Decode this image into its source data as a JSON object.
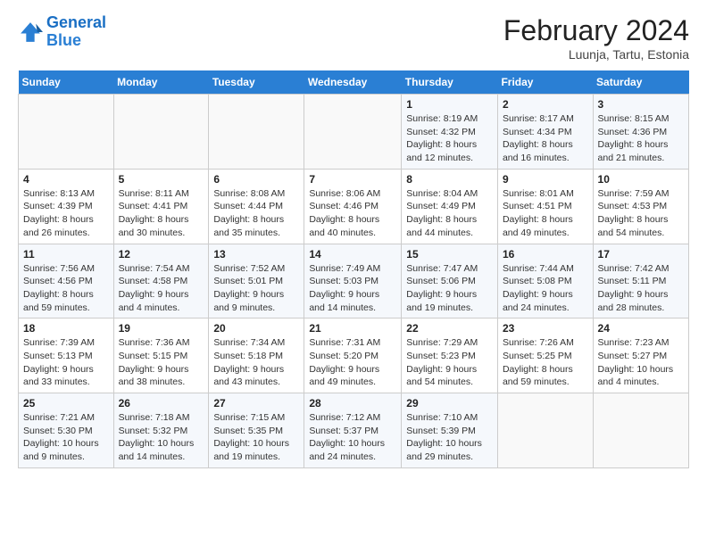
{
  "header": {
    "logo_line1": "General",
    "logo_line2": "Blue",
    "month_year": "February 2024",
    "location": "Luunja, Tartu, Estonia"
  },
  "weekdays": [
    "Sunday",
    "Monday",
    "Tuesday",
    "Wednesday",
    "Thursday",
    "Friday",
    "Saturday"
  ],
  "weeks": [
    [
      {
        "day": "",
        "info": ""
      },
      {
        "day": "",
        "info": ""
      },
      {
        "day": "",
        "info": ""
      },
      {
        "day": "",
        "info": ""
      },
      {
        "day": "1",
        "info": "Sunrise: 8:19 AM\nSunset: 4:32 PM\nDaylight: 8 hours and 12 minutes."
      },
      {
        "day": "2",
        "info": "Sunrise: 8:17 AM\nSunset: 4:34 PM\nDaylight: 8 hours and 16 minutes."
      },
      {
        "day": "3",
        "info": "Sunrise: 8:15 AM\nSunset: 4:36 PM\nDaylight: 8 hours and 21 minutes."
      }
    ],
    [
      {
        "day": "4",
        "info": "Sunrise: 8:13 AM\nSunset: 4:39 PM\nDaylight: 8 hours and 26 minutes."
      },
      {
        "day": "5",
        "info": "Sunrise: 8:11 AM\nSunset: 4:41 PM\nDaylight: 8 hours and 30 minutes."
      },
      {
        "day": "6",
        "info": "Sunrise: 8:08 AM\nSunset: 4:44 PM\nDaylight: 8 hours and 35 minutes."
      },
      {
        "day": "7",
        "info": "Sunrise: 8:06 AM\nSunset: 4:46 PM\nDaylight: 8 hours and 40 minutes."
      },
      {
        "day": "8",
        "info": "Sunrise: 8:04 AM\nSunset: 4:49 PM\nDaylight: 8 hours and 44 minutes."
      },
      {
        "day": "9",
        "info": "Sunrise: 8:01 AM\nSunset: 4:51 PM\nDaylight: 8 hours and 49 minutes."
      },
      {
        "day": "10",
        "info": "Sunrise: 7:59 AM\nSunset: 4:53 PM\nDaylight: 8 hours and 54 minutes."
      }
    ],
    [
      {
        "day": "11",
        "info": "Sunrise: 7:56 AM\nSunset: 4:56 PM\nDaylight: 8 hours and 59 minutes."
      },
      {
        "day": "12",
        "info": "Sunrise: 7:54 AM\nSunset: 4:58 PM\nDaylight: 9 hours and 4 minutes."
      },
      {
        "day": "13",
        "info": "Sunrise: 7:52 AM\nSunset: 5:01 PM\nDaylight: 9 hours and 9 minutes."
      },
      {
        "day": "14",
        "info": "Sunrise: 7:49 AM\nSunset: 5:03 PM\nDaylight: 9 hours and 14 minutes."
      },
      {
        "day": "15",
        "info": "Sunrise: 7:47 AM\nSunset: 5:06 PM\nDaylight: 9 hours and 19 minutes."
      },
      {
        "day": "16",
        "info": "Sunrise: 7:44 AM\nSunset: 5:08 PM\nDaylight: 9 hours and 24 minutes."
      },
      {
        "day": "17",
        "info": "Sunrise: 7:42 AM\nSunset: 5:11 PM\nDaylight: 9 hours and 28 minutes."
      }
    ],
    [
      {
        "day": "18",
        "info": "Sunrise: 7:39 AM\nSunset: 5:13 PM\nDaylight: 9 hours and 33 minutes."
      },
      {
        "day": "19",
        "info": "Sunrise: 7:36 AM\nSunset: 5:15 PM\nDaylight: 9 hours and 38 minutes."
      },
      {
        "day": "20",
        "info": "Sunrise: 7:34 AM\nSunset: 5:18 PM\nDaylight: 9 hours and 43 minutes."
      },
      {
        "day": "21",
        "info": "Sunrise: 7:31 AM\nSunset: 5:20 PM\nDaylight: 9 hours and 49 minutes."
      },
      {
        "day": "22",
        "info": "Sunrise: 7:29 AM\nSunset: 5:23 PM\nDaylight: 9 hours and 54 minutes."
      },
      {
        "day": "23",
        "info": "Sunrise: 7:26 AM\nSunset: 5:25 PM\nDaylight: 8 hours and 59 minutes."
      },
      {
        "day": "24",
        "info": "Sunrise: 7:23 AM\nSunset: 5:27 PM\nDaylight: 10 hours and 4 minutes."
      }
    ],
    [
      {
        "day": "25",
        "info": "Sunrise: 7:21 AM\nSunset: 5:30 PM\nDaylight: 10 hours and 9 minutes."
      },
      {
        "day": "26",
        "info": "Sunrise: 7:18 AM\nSunset: 5:32 PM\nDaylight: 10 hours and 14 minutes."
      },
      {
        "day": "27",
        "info": "Sunrise: 7:15 AM\nSunset: 5:35 PM\nDaylight: 10 hours and 19 minutes."
      },
      {
        "day": "28",
        "info": "Sunrise: 7:12 AM\nSunset: 5:37 PM\nDaylight: 10 hours and 24 minutes."
      },
      {
        "day": "29",
        "info": "Sunrise: 7:10 AM\nSunset: 5:39 PM\nDaylight: 10 hours and 29 minutes."
      },
      {
        "day": "",
        "info": ""
      },
      {
        "day": "",
        "info": ""
      }
    ]
  ]
}
